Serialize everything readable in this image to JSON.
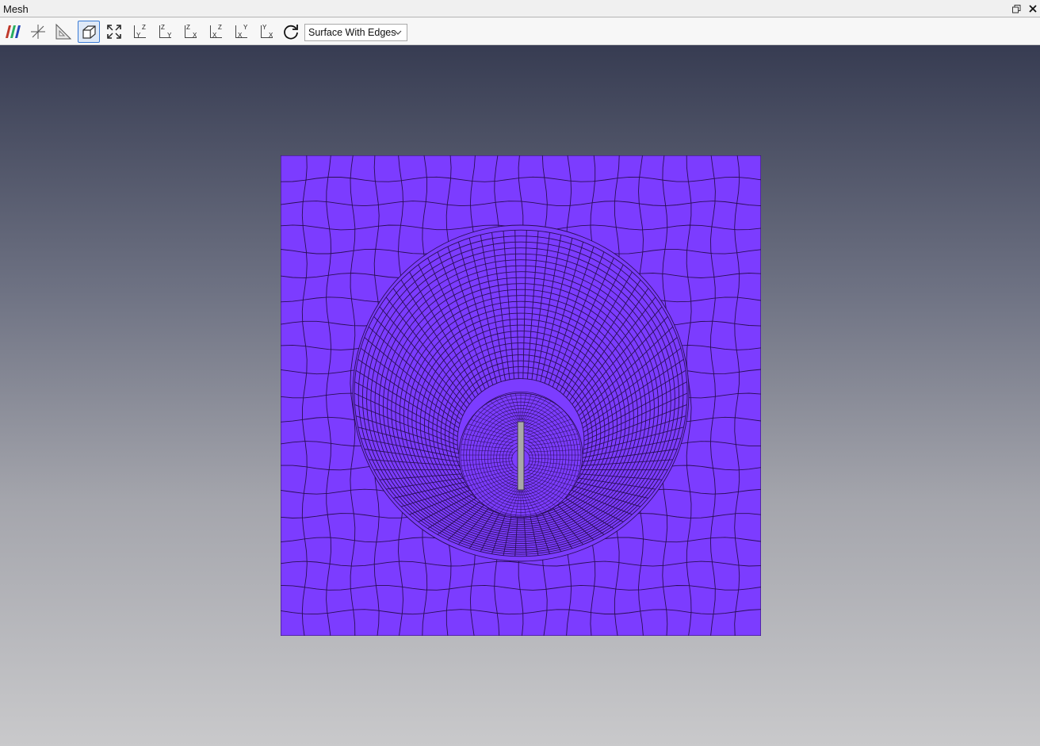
{
  "window": {
    "title": "Mesh",
    "restore_icon": "restore-window-icon",
    "close_icon": "close-icon"
  },
  "toolbar": {
    "buttons": [
      {
        "name": "color-legend-button",
        "icon": "color-bars-icon"
      },
      {
        "name": "axes-toggle-button",
        "icon": "axes-icon"
      },
      {
        "name": "ruler-button",
        "icon": "triangle-ruler-icon"
      },
      {
        "name": "perspective-toggle-button",
        "icon": "perspective-box-icon",
        "active": true
      },
      {
        "name": "reset-camera-button",
        "icon": "fit-view-icon"
      },
      {
        "name": "view-plus-x-button",
        "icon": "view-axis-icon",
        "labels": [
          "Y",
          "Z"
        ]
      },
      {
        "name": "view-minus-x-button",
        "icon": "view-axis-icon",
        "labels": [
          "Z",
          "Y"
        ]
      },
      {
        "name": "view-plus-y-button",
        "icon": "view-axis-icon",
        "labels": [
          "Z",
          "X"
        ]
      },
      {
        "name": "view-minus-y-button",
        "icon": "view-axis-icon",
        "labels": [
          "X",
          "Z"
        ]
      },
      {
        "name": "view-plus-z-button",
        "icon": "view-axis-icon",
        "labels": [
          "X",
          "Y"
        ]
      },
      {
        "name": "view-minus-z-button",
        "icon": "view-axis-icon",
        "labels": [
          "Y",
          "X"
        ]
      },
      {
        "name": "rotate-view-button",
        "icon": "rotate-icon"
      }
    ],
    "representation": {
      "selected": "Surface With Edges"
    }
  },
  "viewport": {
    "background_top": "#373c52",
    "background_bottom": "#c9c9cb",
    "mesh_fill": "#7c3cff",
    "mesh_edge": "#2a0f55",
    "obstacle_fill": "#a8a8a8"
  }
}
